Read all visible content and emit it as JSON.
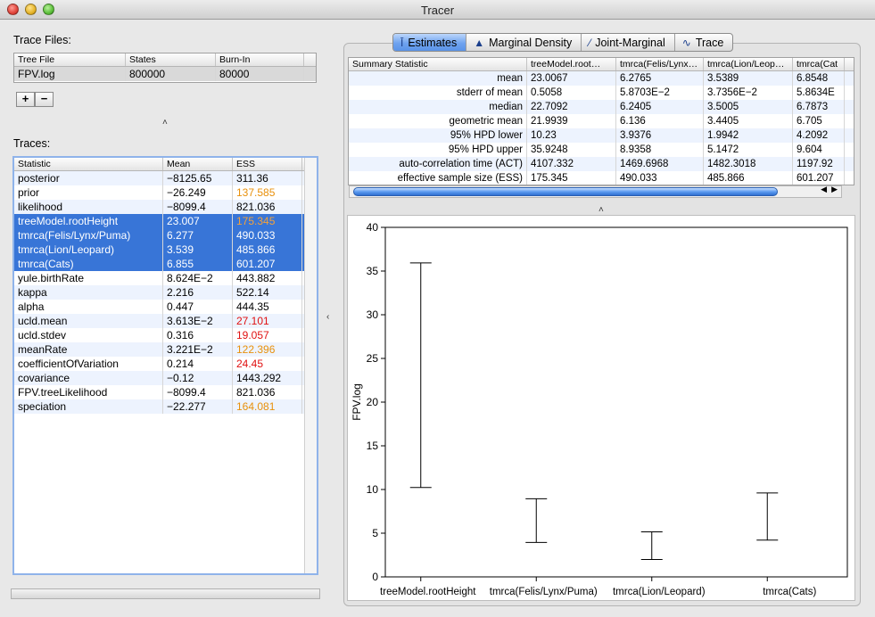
{
  "window": {
    "title": "Tracer"
  },
  "trace_files": {
    "label": "Trace Files:",
    "columns": [
      "Tree File",
      "States",
      "Burn-In"
    ],
    "rows": [
      {
        "file": "FPV.log",
        "states": "800000",
        "burnin": "80000"
      }
    ],
    "add_label": "+",
    "remove_label": "−"
  },
  "traces": {
    "label": "Traces:",
    "columns": [
      "Statistic",
      "Mean",
      "ESS"
    ],
    "rows": [
      {
        "stat": "posterior",
        "mean": "−8125.65",
        "ess": "311.36",
        "ess_color": "#000000",
        "selected": false
      },
      {
        "stat": "prior",
        "mean": "−26.249",
        "ess": "137.585",
        "ess_color": "#e8900c",
        "selected": false
      },
      {
        "stat": "likelihood",
        "mean": "−8099.4",
        "ess": "821.036",
        "ess_color": "#000000",
        "selected": false
      },
      {
        "stat": "treeModel.rootHeight",
        "mean": "23.007",
        "ess": "175.345",
        "ess_color": "#f3a13a",
        "selected": true
      },
      {
        "stat": "tmrca(Felis/Lynx/Puma)",
        "mean": "6.277",
        "ess": "490.033",
        "ess_color": "#ffffff",
        "selected": true
      },
      {
        "stat": "tmrca(Lion/Leopard)",
        "mean": "3.539",
        "ess": "485.866",
        "ess_color": "#ffffff",
        "selected": true
      },
      {
        "stat": "tmrca(Cats)",
        "mean": "6.855",
        "ess": "601.207",
        "ess_color": "#ffffff",
        "selected": true
      },
      {
        "stat": "yule.birthRate",
        "mean": "8.624E−2",
        "ess": "443.882",
        "ess_color": "#000000",
        "selected": false
      },
      {
        "stat": "kappa",
        "mean": "2.216",
        "ess": "522.14",
        "ess_color": "#000000",
        "selected": false
      },
      {
        "stat": "alpha",
        "mean": "0.447",
        "ess": "444.35",
        "ess_color": "#000000",
        "selected": false
      },
      {
        "stat": "ucld.mean",
        "mean": "3.613E−2",
        "ess": "27.101",
        "ess_color": "#e01010",
        "selected": false
      },
      {
        "stat": "ucld.stdev",
        "mean": "0.316",
        "ess": "19.057",
        "ess_color": "#e01010",
        "selected": false
      },
      {
        "stat": "meanRate",
        "mean": "3.221E−2",
        "ess": "122.396",
        "ess_color": "#e8900c",
        "selected": false
      },
      {
        "stat": "coefficientOfVariation",
        "mean": "0.214",
        "ess": "24.45",
        "ess_color": "#e01010",
        "selected": false
      },
      {
        "stat": "covariance",
        "mean": "−0.12",
        "ess": "1443.292",
        "ess_color": "#000000",
        "selected": false
      },
      {
        "stat": "FPV.treeLikelihood",
        "mean": "−8099.4",
        "ess": "821.036",
        "ess_color": "#000000",
        "selected": false
      },
      {
        "stat": "speciation",
        "mean": "−22.277",
        "ess": "164.081",
        "ess_color": "#e8900c",
        "selected": false
      }
    ]
  },
  "tabs": [
    {
      "label": "Estimates",
      "icon": "estimates-icon",
      "active": true
    },
    {
      "label": "Marginal Density",
      "icon": "density-icon",
      "active": false
    },
    {
      "label": "Joint-Marginal",
      "icon": "joint-marginal-icon",
      "active": false
    },
    {
      "label": "Trace",
      "icon": "trace-icon",
      "active": false
    }
  ],
  "summary": {
    "columns": [
      "Summary Statistic",
      "treeModel.root…",
      "tmrca(Felis/Lynx…",
      "tmrca(Lion/Leop…",
      "tmrca(Cat"
    ],
    "rows": [
      [
        "mean",
        "23.0067",
        "6.2765",
        "3.5389",
        "6.8548"
      ],
      [
        "stderr of mean",
        "0.5058",
        "5.8703E−2",
        "3.7356E−2",
        "5.8634E"
      ],
      [
        "median",
        "22.7092",
        "6.2405",
        "3.5005",
        "6.7873"
      ],
      [
        "geometric mean",
        "21.9939",
        "6.136",
        "3.4405",
        "6.705"
      ],
      [
        "95% HPD lower",
        "10.23",
        "3.9376",
        "1.9942",
        "4.2092"
      ],
      [
        "95% HPD upper",
        "35.9248",
        "8.9358",
        "5.1472",
        "9.604"
      ],
      [
        "auto-correlation time (ACT)",
        "4107.332",
        "1469.6968",
        "1482.3018",
        "1197.92"
      ],
      [
        "effective sample size (ESS)",
        "175.345",
        "490.033",
        "485.866",
        "601.207"
      ]
    ]
  },
  "chart_data": {
    "type": "errorbar",
    "ylabel": "FPV.log",
    "ylim": [
      0,
      40
    ],
    "yticks": [
      "0",
      "5",
      "10",
      "15",
      "20",
      "25",
      "30",
      "35",
      "40"
    ],
    "categories": [
      "treeModel.rootHeight",
      "tmrca(Felis/Lynx/Puma)",
      "tmrca(Lion/Leopard)",
      "tmrca(Cats)"
    ],
    "lower": [
      10.23,
      3.9376,
      1.9942,
      4.2092
    ],
    "upper": [
      35.9248,
      8.9358,
      5.1472,
      9.604
    ]
  }
}
